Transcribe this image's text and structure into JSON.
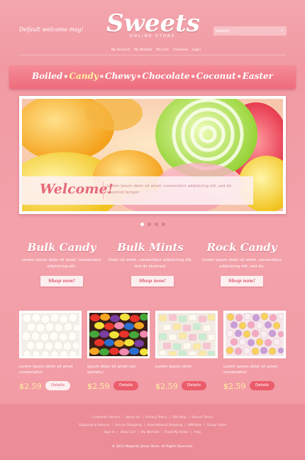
{
  "header": {
    "welcome": "Default welcome msg!",
    "logo_title": "Sweets",
    "logo_subtitle": "ONLINE STORE",
    "search_placeholder": "Search ...",
    "search_icon": "chevron-right-icon",
    "account_links": [
      "My Account",
      "My Wishlist",
      "My Cart",
      "Checkout",
      "Login"
    ]
  },
  "nav": {
    "categories": [
      "Boiled",
      "Candy",
      "Chewy",
      "Chocolate",
      "Coconut",
      "Easter"
    ],
    "active": "Candy"
  },
  "slider": {
    "welcome_title": "Welcome!",
    "welcome_text": "Lorem ipsum dolor sit amet, consectetur adipisicing elit, sed do eiusmod tempor",
    "pager_count": 4,
    "pager_active": 1
  },
  "features": [
    {
      "title": "Bulk Candy",
      "text": "Lorem ipsum dolor sit amet, consectetur adipisicing elit.",
      "button": "Shop now!"
    },
    {
      "title": "Bulk Mints",
      "text": "Dolor sit amet, consectetur adipisicing elit, sed do eiusmod.",
      "button": "Shop now!"
    },
    {
      "title": "Rock Candy",
      "text": "Lorem ipsum dolor sit amet, consectetur adipisicing elit, sed do.",
      "button": "Shop now!"
    }
  ],
  "products": [
    {
      "desc": "Lorem ipsum dolor sit amet consectetur",
      "price": "$2.59",
      "button": "Details"
    },
    {
      "desc": "Ipsum dolor sit amet con-sectetur",
      "price": "$2.59",
      "button": "Details"
    },
    {
      "desc": "Lorem ipsum dolor",
      "price": "$2.59",
      "button": "Details"
    },
    {
      "desc": "Lorem ipsum dolor sit amet consectetur",
      "price": "$2.59",
      "button": "Details"
    }
  ],
  "footer": {
    "row1": [
      "Customer Service",
      "About Us",
      "Privacy Policy",
      "Site Map",
      "Search Terms"
    ],
    "row2": [
      "Shipping & Returns",
      "Secure Shopping",
      "International Shipping",
      "Affiliates",
      "Group Sales"
    ],
    "row3": [
      "Sign In",
      "View Cart",
      "My Wishlist",
      "Track My Order",
      "Help"
    ],
    "copyright": "© 2013 Magento Demo Store. All Rights Reserved."
  },
  "colors": {
    "accent": "#ec5d6c",
    "background": "#f19aa4",
    "price": "#fff2a0"
  }
}
